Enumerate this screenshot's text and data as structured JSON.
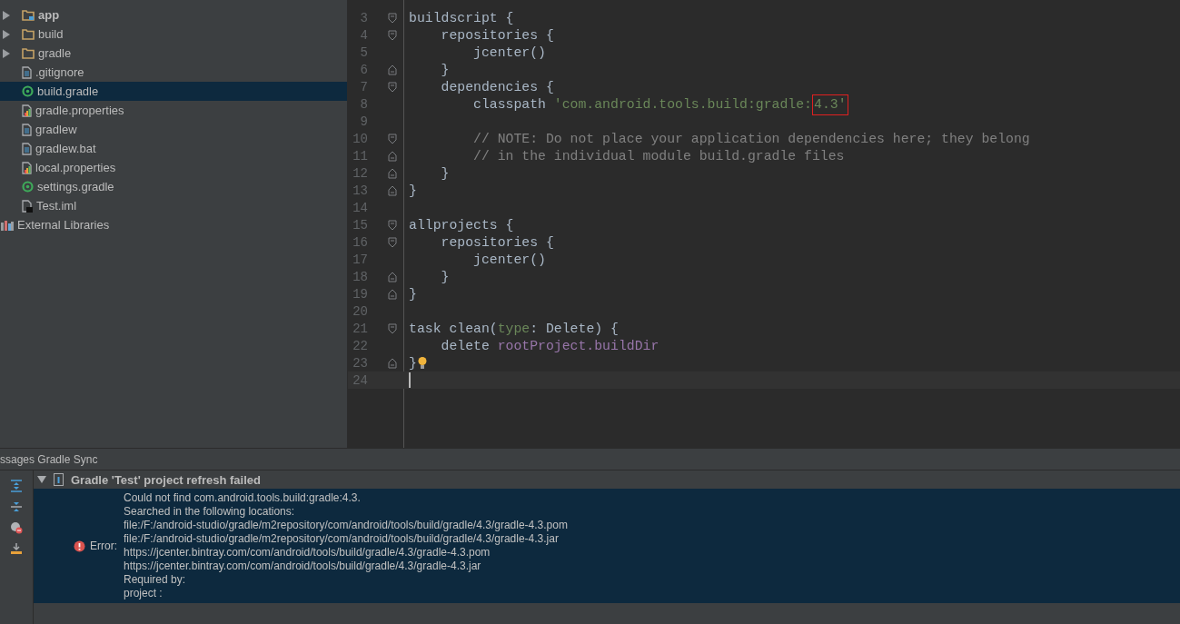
{
  "project_tree": {
    "items": [
      {
        "label": "app",
        "kind": "module",
        "selected": false
      },
      {
        "label": "build",
        "kind": "folder",
        "selected": false
      },
      {
        "label": "gradle",
        "kind": "folder",
        "selected": false
      },
      {
        "label": ".gitignore",
        "kind": "text-file",
        "selected": false
      },
      {
        "label": "build.gradle",
        "kind": "gradle-file",
        "selected": true
      },
      {
        "label": "gradle.properties",
        "kind": "properties-file",
        "selected": false
      },
      {
        "label": "gradlew",
        "kind": "text-file",
        "selected": false
      },
      {
        "label": "gradlew.bat",
        "kind": "text-file",
        "selected": false
      },
      {
        "label": "local.properties",
        "kind": "properties-file",
        "selected": false
      },
      {
        "label": "settings.gradle",
        "kind": "gradle-file",
        "selected": false
      },
      {
        "label": "Test.iml",
        "kind": "iml-file",
        "selected": false
      }
    ],
    "external": {
      "label": "External Libraries"
    }
  },
  "editor": {
    "lines": [
      {
        "number": "3",
        "kind": "block-start",
        "tokens": [
          {
            "kind": "plain",
            "text": "buildscript {"
          }
        ]
      },
      {
        "number": "4",
        "kind": "block-start",
        "tokens": [
          {
            "kind": "plain",
            "text": "    repositories {"
          }
        ]
      },
      {
        "number": "5",
        "kind": "plain",
        "tokens": [
          {
            "kind": "plain",
            "text": "        jcenter()"
          }
        ]
      },
      {
        "number": "6",
        "kind": "block-end",
        "tokens": [
          {
            "kind": "plain",
            "text": "    }"
          }
        ]
      },
      {
        "number": "7",
        "kind": "block-start",
        "tokens": [
          {
            "kind": "plain",
            "text": "    dependencies {"
          }
        ]
      },
      {
        "number": "8",
        "kind": "plain",
        "tokens": [
          {
            "kind": "plain",
            "text": "        classpath "
          },
          {
            "kind": "string",
            "text": "'com.android.tools.build:gradle:"
          },
          {
            "kind": "string",
            "text": "4.3'",
            "marked": true
          }
        ]
      },
      {
        "number": "9",
        "kind": "plain"
      },
      {
        "number": "10",
        "kind": "block-start",
        "tokens": [
          {
            "kind": "comment",
            "text": "        // NOTE: Do not place your application dependencies here; they belong"
          }
        ]
      },
      {
        "number": "11",
        "kind": "block-end",
        "tokens": [
          {
            "kind": "comment",
            "text": "        // in the individual module build.gradle files"
          }
        ]
      },
      {
        "number": "12",
        "kind": "block-end",
        "tokens": [
          {
            "kind": "plain",
            "text": "    }"
          }
        ]
      },
      {
        "number": "13",
        "kind": "block-end",
        "tokens": [
          {
            "kind": "plain",
            "text": "}"
          }
        ]
      },
      {
        "number": "14",
        "kind": "plain"
      },
      {
        "number": "15",
        "kind": "block-start",
        "tokens": [
          {
            "kind": "plain",
            "text": "allprojects {"
          }
        ]
      },
      {
        "number": "16",
        "kind": "block-start",
        "tokens": [
          {
            "kind": "plain",
            "text": "    repositories {"
          }
        ]
      },
      {
        "number": "17",
        "kind": "plain",
        "tokens": [
          {
            "kind": "plain",
            "text": "        jcenter()"
          }
        ]
      },
      {
        "number": "18",
        "kind": "block-end",
        "tokens": [
          {
            "kind": "plain",
            "text": "    }"
          }
        ]
      },
      {
        "number": "19",
        "kind": "block-end",
        "tokens": [
          {
            "kind": "plain",
            "text": "}"
          }
        ]
      },
      {
        "number": "20",
        "kind": "plain"
      },
      {
        "number": "21",
        "kind": "block-start",
        "tokens": [
          {
            "kind": "plain",
            "text": "task clean("
          },
          {
            "kind": "param",
            "text": "type"
          },
          {
            "kind": "plain",
            "text": ": Delete) {"
          }
        ]
      },
      {
        "number": "22",
        "kind": "plain",
        "tokens": [
          {
            "kind": "plain",
            "text": "    delete "
          },
          {
            "kind": "field",
            "text": "rootProject.buildDir"
          }
        ]
      },
      {
        "number": "23",
        "kind": "block-end",
        "tokens": [
          {
            "kind": "plain",
            "text": "}"
          }
        ],
        "bulb": true
      },
      {
        "number": "24",
        "kind": "plain",
        "current": true
      }
    ]
  },
  "messages_panel": {
    "tabs_title": "ssages Gradle Sync",
    "header": {
      "title": "Gradle 'Test' project refresh failed",
      "expanded": true
    },
    "error": {
      "label": "Error:",
      "lines": [
        "Could not find com.android.tools.build:gradle:4.3.",
        "Searched in the following locations:",
        "file:/F:/android-studio/gradle/m2repository/com/android/tools/build/gradle/4.3/gradle-4.3.pom",
        "file:/F:/android-studio/gradle/m2repository/com/android/tools/build/gradle/4.3/gradle-4.3.jar",
        "https://jcenter.bintray.com/com/android/tools/build/gradle/4.3/gradle-4.3.pom",
        "https://jcenter.bintray.com/com/android/tools/build/gradle/4.3/gradle-4.3.jar",
        "Required by:",
        "project :"
      ]
    }
  }
}
